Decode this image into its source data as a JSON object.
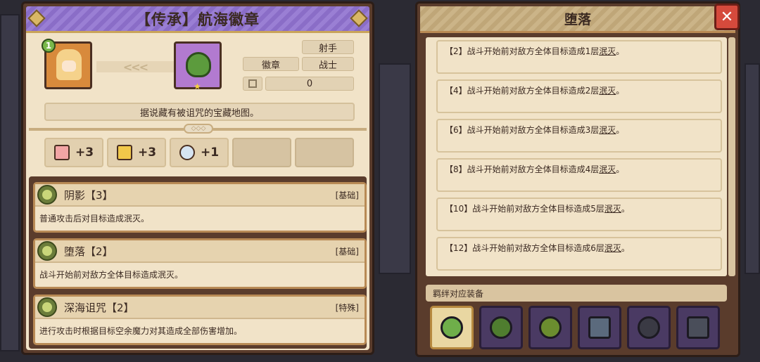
{
  "left": {
    "title": "【传承】航海徽章",
    "hero_level": "1",
    "arrows": "<<<",
    "tags": [
      "射手",
      "徽章",
      "战士"
    ],
    "count": "0",
    "description": "据说藏有被诅咒的宝藏地图。",
    "materials": [
      {
        "icon": "pink-stone-icon",
        "amount": "+3",
        "color": "#f2a5a5"
      },
      {
        "icon": "gold-bar-icon",
        "amount": "+3",
        "color": "#f1c84a"
      },
      {
        "icon": "crystal-icon",
        "amount": "+1",
        "color": "#d6e4f2"
      }
    ],
    "skills": [
      {
        "name": "阴影【3】",
        "tag": "[基础]",
        "text": "普通攻击后对目标造成泯灭。"
      },
      {
        "name": "堕落【2】",
        "tag": "[基础]",
        "text": "战斗开始前对敌方全体目标造成泯灭。"
      },
      {
        "name": "深海诅咒【2】",
        "tag": "[特殊]",
        "text": "进行攻击时根据目标空余魔力对其造成全部伤害增加。"
      }
    ]
  },
  "right": {
    "title": "堕落",
    "close": "✕",
    "items": [
      {
        "prefix": "【2】战斗开始前对敌方全体目标造成1层",
        "keyword": "泯灭",
        "suffix": "。"
      },
      {
        "prefix": "【4】战斗开始前对敌方全体目标造成2层",
        "keyword": "泯灭",
        "suffix": "。"
      },
      {
        "prefix": "【6】战斗开始前对敌方全体目标造成3层",
        "keyword": "泯灭",
        "suffix": "。"
      },
      {
        "prefix": "【8】战斗开始前对敌方全体目标造成4层",
        "keyword": "泯灭",
        "suffix": "。"
      },
      {
        "prefix": "【10】战斗开始前对敌方全体目标造成5层",
        "keyword": "泯灭",
        "suffix": "。"
      },
      {
        "prefix": "【12】战斗开始前对敌方全体目标造成6层",
        "keyword": "泯灭",
        "suffix": "。"
      }
    ],
    "bond_label": "羁绊对应装备",
    "equipment": [
      {
        "name": "clover-badge-icon",
        "selected": true,
        "color": "#6fae4a"
      },
      {
        "name": "ring-icon",
        "selected": false,
        "color": "#4f7d2f"
      },
      {
        "name": "necklace-icon",
        "selected": false,
        "color": "#6b8d2f"
      },
      {
        "name": "boots-icon",
        "selected": false,
        "color": "#5b6a7d"
      },
      {
        "name": "bracelet-icon",
        "selected": false,
        "color": "#3a3a44"
      },
      {
        "name": "gauntlet-icon",
        "selected": false,
        "color": "#4a4e5a"
      }
    ]
  }
}
